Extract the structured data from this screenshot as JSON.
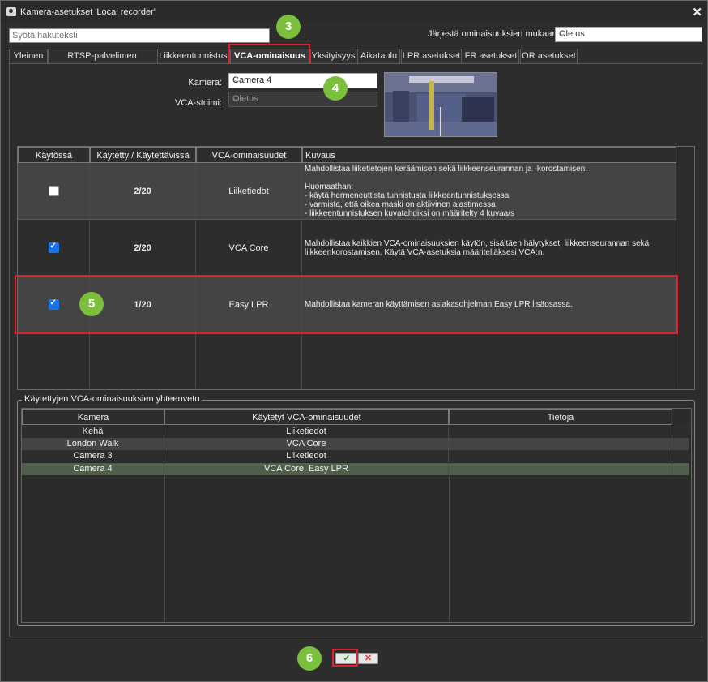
{
  "window": {
    "title": "Kamera-asetukset 'Local recorder'"
  },
  "search": {
    "placeholder": "Syötä hakuteksti"
  },
  "sort": {
    "label": "Järjestä ominaisuuksien mukaan:",
    "value": "Oletus"
  },
  "tabs": [
    {
      "label": "Yleinen"
    },
    {
      "label": "RTSP-palvelimen striimaus"
    },
    {
      "label": "Liikkeentunnistus"
    },
    {
      "label": "VCA-ominaisuus",
      "active": true
    },
    {
      "label": "Yksityisyys"
    },
    {
      "label": "Aikataulu"
    },
    {
      "label": "LPR asetukset"
    },
    {
      "label": "FR asetukset"
    },
    {
      "label": "OR asetukset"
    }
  ],
  "camera": {
    "label": "Kamera:",
    "value": "Camera 4"
  },
  "stream": {
    "label": "VCA-striimi:",
    "value": "Oletus"
  },
  "features_table": {
    "headers": [
      "Käytössä",
      "Käytetty / Käytettävissä",
      "VCA-ominaisuudet",
      "Kuvaus"
    ],
    "rows": [
      {
        "enabled": false,
        "usage": "2/20",
        "name": "Liiketiedot",
        "description": "Mahdollistaa liiketietojen keräämisen sekä liikkeenseurannan ja -korostamisen.\n\nHuomaathan:\n- käytä hermeneuttista tunnistusta liikkeentunnistuksessa\n- varmista, että oikea maski on aktiivinen ajastimessa\n- liikkeentunnistuksen kuvatahdiksi on määritelty 4 kuvaa/s"
      },
      {
        "enabled": true,
        "usage": "2/20",
        "name": "VCA Core",
        "description": "Mahdollistaa kaikkien VCA-ominaisuuksien käytön, sisältäen hälytykset, liikkeenseurannan sekä\nliikkeenkorostamisen. Käytä VCA-asetuksia määritelläksesi VCA:n."
      },
      {
        "enabled": true,
        "usage": "1/20",
        "name": "Easy LPR",
        "description": "Mahdollistaa kameran käyttämisen asiakasohjelman Easy LPR lisäosassa."
      }
    ]
  },
  "summary": {
    "title": "Käytettyjen VCA-ominaisuuksien yhteenveto",
    "headers": [
      "Kamera",
      "Käytetyt VCA-ominaisuudet",
      "Tietoja"
    ],
    "rows": [
      {
        "camera": "Kehä",
        "features": "Liiketiedot",
        "info": ""
      },
      {
        "camera": "London Walk",
        "features": "VCA Core",
        "info": ""
      },
      {
        "camera": "Camera 3",
        "features": "Liiketiedot",
        "info": ""
      },
      {
        "camera": "Camera 4",
        "features": "VCA Core, Easy LPR",
        "info": "",
        "selected": true
      }
    ]
  },
  "buttons": {
    "ok": "✓",
    "cancel": "✕"
  },
  "callouts": {
    "tab": "3",
    "camera": "4",
    "row": "5",
    "ok": "6"
  },
  "colors": {
    "accent_red": "#e0212b",
    "badge_green": "#7cbf3c",
    "selected_row": "#4f5f4a",
    "checkbox_blue": "#1a73e8"
  }
}
